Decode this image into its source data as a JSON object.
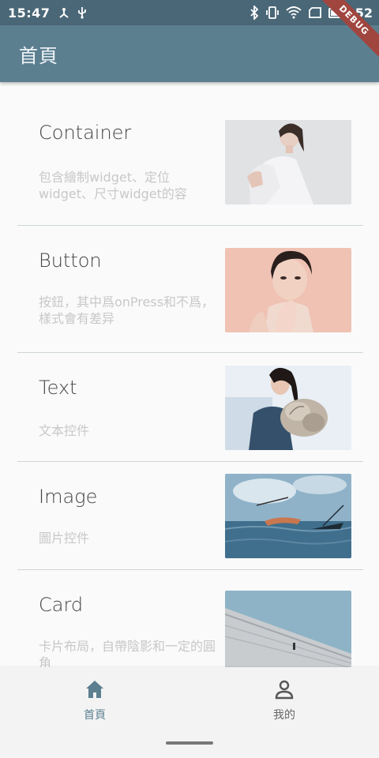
{
  "status_bar": {
    "time": "15:47",
    "battery": "52",
    "battery_level": 0.52,
    "left_icons": [
      "usb-tether-icon",
      "usb-icon"
    ],
    "right_icons": [
      "bluetooth-icon",
      "vibrate-icon",
      "wifi-icon",
      "sim-icon",
      "battery-icon"
    ]
  },
  "debug_banner": "DEBUG",
  "app_bar": {
    "title": "首頁"
  },
  "items": [
    {
      "title": "Container",
      "desc": "包含繪制widget、定位widget、尺寸widget的容",
      "image": "photo-woman-white-shirt"
    },
    {
      "title": "Button",
      "desc": "按鈕，其中爲onPress和不爲，樣式會有差异",
      "image": "photo-woman-pink-background"
    },
    {
      "title": "Text",
      "desc": "文本控件",
      "image": "photo-woman-holding-flowers"
    },
    {
      "title": "Image",
      "desc": "圖片控件",
      "image": "photo-boats-on-sea"
    },
    {
      "title": "Card",
      "desc": "卡片布局，自帶陰影和一定的圓角",
      "image": "photo-architecture-wall"
    }
  ],
  "bottom_nav": {
    "items": [
      {
        "label": "首頁",
        "icon": "home-icon",
        "active": true
      },
      {
        "label": "我的",
        "icon": "person-icon",
        "active": false
      }
    ]
  },
  "colors": {
    "primary": "#5c7f90",
    "status_bar": "#4a6777",
    "divider": "#cfd5d8",
    "desc_text": "#c8c8c8"
  }
}
